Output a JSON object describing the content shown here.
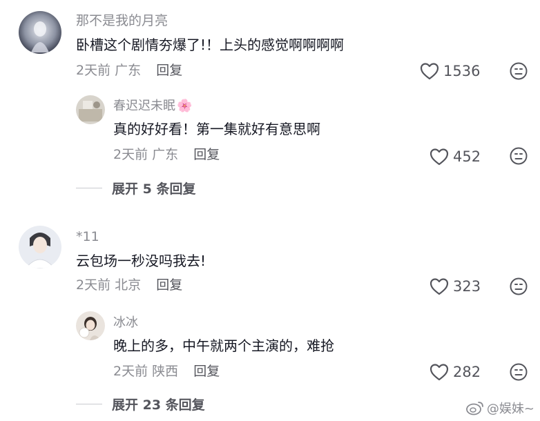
{
  "comments": [
    {
      "username": "那不是我的月亮",
      "text": "卧槽这个剧情夯爆了!！上头的感觉啊啊啊啊",
      "time": "2天前",
      "location": "广东",
      "reply_label": "回复",
      "likes": "1536",
      "reply": {
        "username": "春迟迟未眠",
        "username_emoji": "🌸",
        "text": "真的好好看！第一集就好有意思啊",
        "time": "2天前",
        "location": "广东",
        "reply_label": "回复",
        "likes": "452"
      },
      "expand_label": "展开 5 条回复"
    },
    {
      "username": "*11",
      "text": "云包场一秒没吗我去!",
      "time": "2天前",
      "location": "北京",
      "reply_label": "回复",
      "likes": "323",
      "reply": {
        "username": "冰冰",
        "text": "晚上的多，中午就两个主演的，难抢",
        "time": "2天前",
        "location": "陕西",
        "reply_label": "回复",
        "likes": "282"
      },
      "expand_label": "展开 23 条回复"
    }
  ],
  "watermark": "@娱妹~",
  "colors": {
    "primary_text": "#161823",
    "secondary_text": "#8a8b91",
    "action_text": "#54555c"
  }
}
